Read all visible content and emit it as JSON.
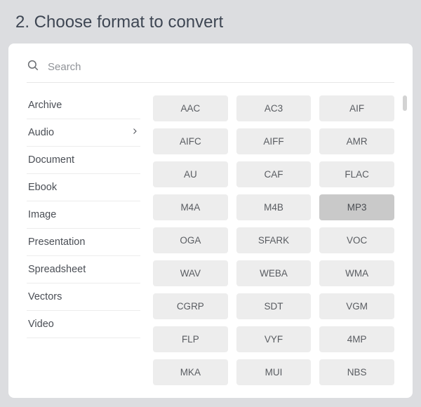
{
  "header": {
    "title": "2. Choose format to convert"
  },
  "search": {
    "placeholder": "Search"
  },
  "categories": [
    {
      "label": "Archive",
      "active": false
    },
    {
      "label": "Audio",
      "active": true
    },
    {
      "label": "Document",
      "active": false
    },
    {
      "label": "Ebook",
      "active": false
    },
    {
      "label": "Image",
      "active": false
    },
    {
      "label": "Presentation",
      "active": false
    },
    {
      "label": "Spreadsheet",
      "active": false
    },
    {
      "label": "Vectors",
      "active": false
    },
    {
      "label": "Video",
      "active": false
    }
  ],
  "formats": [
    {
      "label": "AAC",
      "selected": false
    },
    {
      "label": "AC3",
      "selected": false
    },
    {
      "label": "AIF",
      "selected": false
    },
    {
      "label": "AIFC",
      "selected": false
    },
    {
      "label": "AIFF",
      "selected": false
    },
    {
      "label": "AMR",
      "selected": false
    },
    {
      "label": "AU",
      "selected": false
    },
    {
      "label": "CAF",
      "selected": false
    },
    {
      "label": "FLAC",
      "selected": false
    },
    {
      "label": "M4A",
      "selected": false
    },
    {
      "label": "M4B",
      "selected": false
    },
    {
      "label": "MP3",
      "selected": true
    },
    {
      "label": "OGA",
      "selected": false
    },
    {
      "label": "SFARK",
      "selected": false
    },
    {
      "label": "VOC",
      "selected": false
    },
    {
      "label": "WAV",
      "selected": false
    },
    {
      "label": "WEBA",
      "selected": false
    },
    {
      "label": "WMA",
      "selected": false
    },
    {
      "label": "CGRP",
      "selected": false
    },
    {
      "label": "SDT",
      "selected": false
    },
    {
      "label": "VGM",
      "selected": false
    },
    {
      "label": "FLP",
      "selected": false
    },
    {
      "label": "VYF",
      "selected": false
    },
    {
      "label": "4MP",
      "selected": false
    },
    {
      "label": "MKA",
      "selected": false
    },
    {
      "label": "MUI",
      "selected": false
    },
    {
      "label": "NBS",
      "selected": false
    }
  ]
}
